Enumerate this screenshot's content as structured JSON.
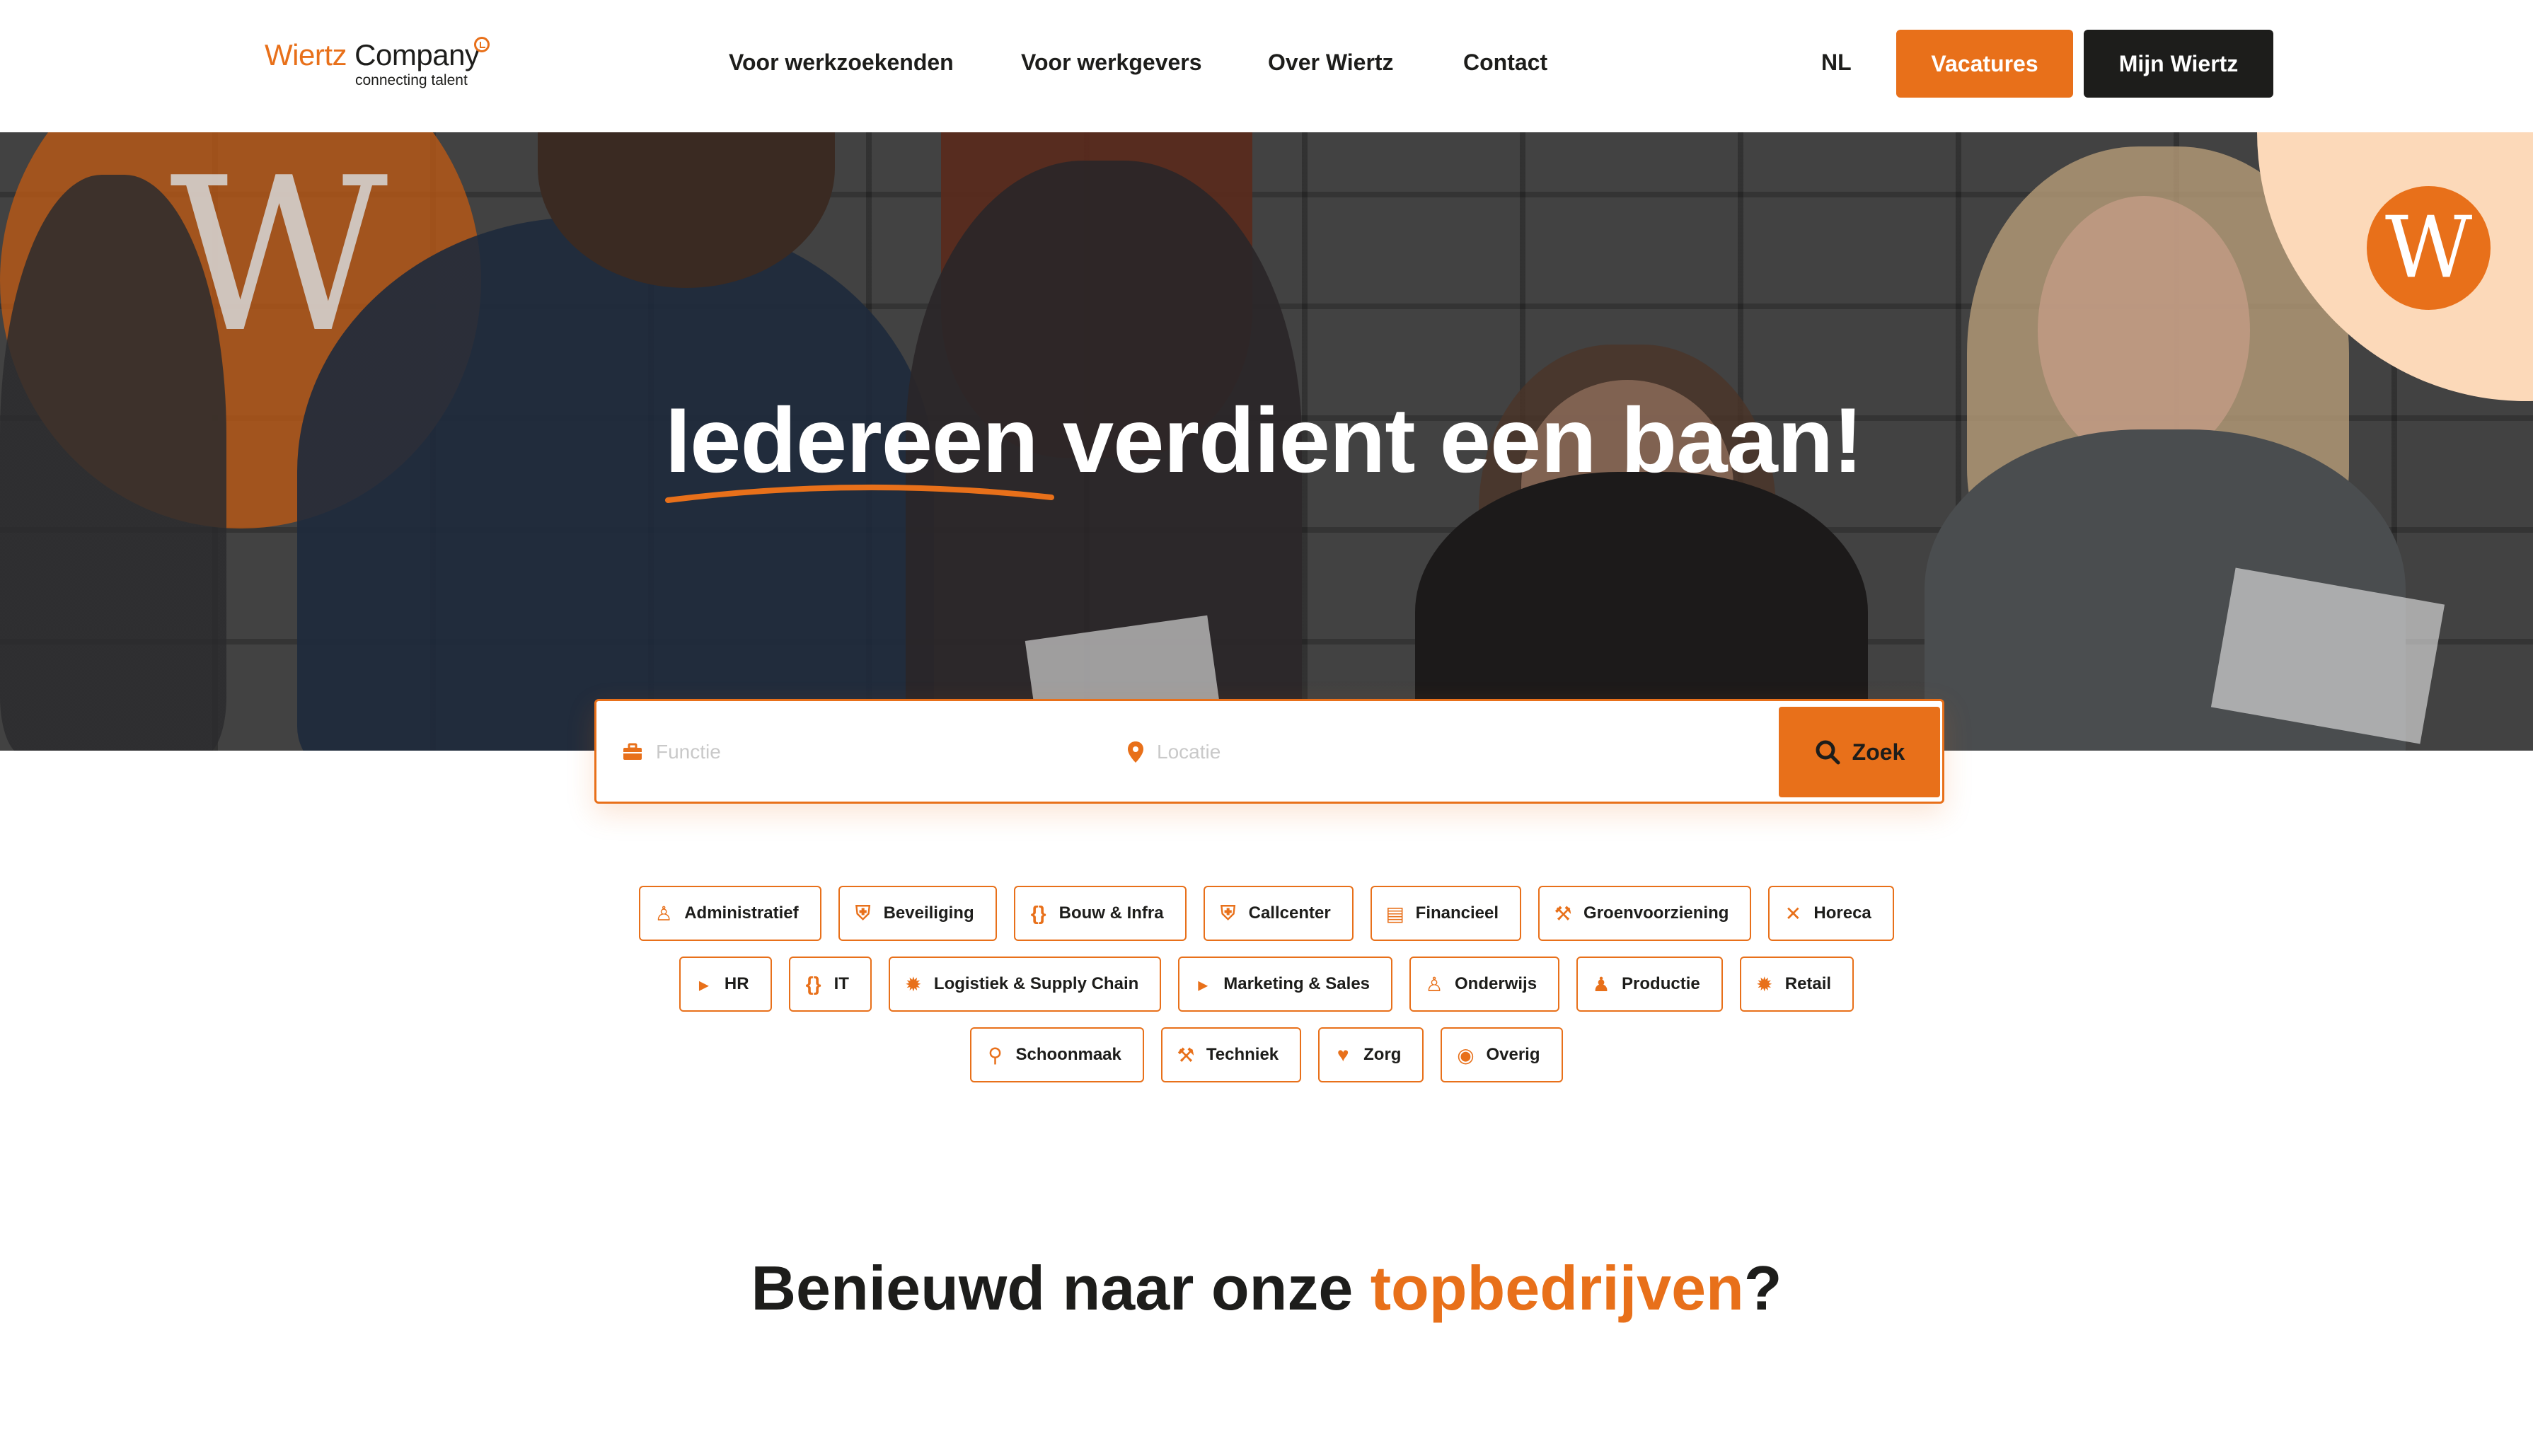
{
  "brand": {
    "name_part1": "Wiertz",
    "name_part2": "Company",
    "tagline": "connecting talent",
    "accent": "#e8701a",
    "dark": "#1d1d1b"
  },
  "nav": {
    "items": [
      {
        "label": "Voor werkzoekenden"
      },
      {
        "label": "Voor werkgevers"
      },
      {
        "label": "Over Wiertz"
      },
      {
        "label": "Contact"
      }
    ],
    "language": "NL",
    "vacatures_label": "Vacatures",
    "mijn_label": "Mijn Wiertz"
  },
  "hero": {
    "title_highlight": "Iedereen",
    "title_rest": "verdient een baan!",
    "badge_letter": "W"
  },
  "search": {
    "function_placeholder": "Functie",
    "location_placeholder": "Locatie",
    "button_label": "Zoek",
    "function_icon": "briefcase-icon",
    "location_icon": "map-pin-icon",
    "button_icon": "search-icon"
  },
  "categories": {
    "row1": [
      {
        "label": "Administratief",
        "icon": "person-desk-icon"
      },
      {
        "label": "Beveiliging",
        "icon": "shield-icon"
      },
      {
        "label": "Bouw & Infra",
        "icon": "code-braces-icon"
      },
      {
        "label": "Callcenter",
        "icon": "shield-icon"
      },
      {
        "label": "Financieel",
        "icon": "money-icon"
      },
      {
        "label": "Groenvoorziening",
        "icon": "tools-icon"
      },
      {
        "label": "Horeca",
        "icon": "utensils-icon"
      }
    ],
    "row2": [
      {
        "label": "HR",
        "icon": "megaphone-icon"
      },
      {
        "label": "IT",
        "icon": "code-braces-icon"
      },
      {
        "label": "Logistiek & Supply Chain",
        "icon": "gear-badge-icon"
      },
      {
        "label": "Marketing & Sales",
        "icon": "megaphone-icon"
      },
      {
        "label": "Onderwijs",
        "icon": "teacher-icon"
      },
      {
        "label": "Productie",
        "icon": "worker-icon"
      },
      {
        "label": "Retail",
        "icon": "gear-badge-icon"
      }
    ],
    "row3": [
      {
        "label": "Schoonmaak",
        "icon": "spray-icon"
      },
      {
        "label": "Techniek",
        "icon": "tools-icon"
      },
      {
        "label": "Zorg",
        "icon": "care-icon"
      },
      {
        "label": "Overig",
        "icon": "globe-icon"
      }
    ]
  },
  "bottom": {
    "prefix": "Benieuwd naar onze ",
    "highlight": "topbedrijven",
    "suffix": "?"
  }
}
